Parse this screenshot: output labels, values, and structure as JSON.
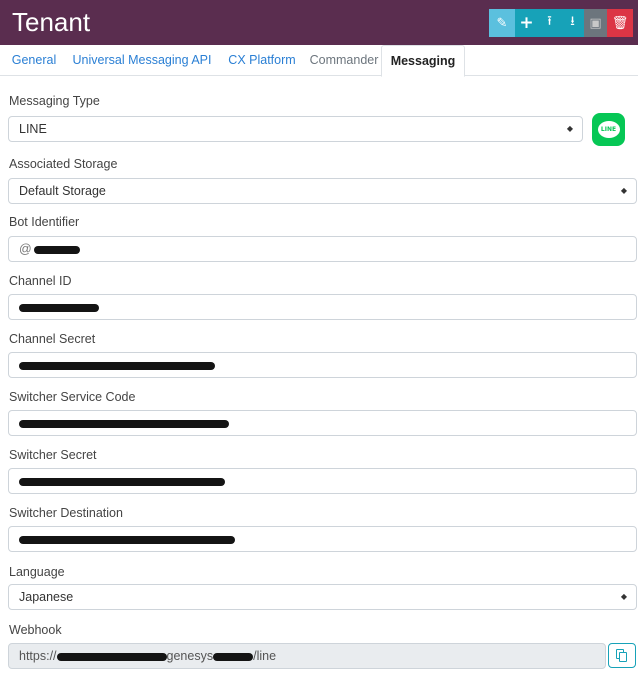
{
  "header": {
    "title": "Tenant",
    "actions": [
      {
        "name": "edit",
        "icon": "pencil-icon",
        "glyph": "✎"
      },
      {
        "name": "add",
        "icon": "plus-icon",
        "glyph": "+"
      },
      {
        "name": "upload",
        "icon": "upload-icon",
        "glyph": "⭱"
      },
      {
        "name": "download",
        "icon": "download-icon",
        "glyph": "⭳"
      },
      {
        "name": "save",
        "icon": "save-icon",
        "glyph": "▣"
      },
      {
        "name": "delete",
        "icon": "trash-icon",
        "glyph": "🗑"
      }
    ]
  },
  "tabs": [
    {
      "label": "General",
      "active": false
    },
    {
      "label": "Universal Messaging API",
      "active": false
    },
    {
      "label": "CX Platform",
      "active": false
    },
    {
      "label": "Commander",
      "active": false
    },
    {
      "label": "Messaging",
      "active": true
    }
  ],
  "form": {
    "messaging_type": {
      "label": "Messaging Type",
      "value": "LINE",
      "badge": "LINE"
    },
    "associated_storage": {
      "label": "Associated Storage",
      "value": "Default Storage"
    },
    "bot_identifier": {
      "label": "Bot Identifier",
      "prefix": "@"
    },
    "channel_id": {
      "label": "Channel ID"
    },
    "channel_secret": {
      "label": "Channel Secret"
    },
    "switcher_service_code": {
      "label": "Switcher Service Code"
    },
    "switcher_secret": {
      "label": "Switcher Secret"
    },
    "switcher_destination": {
      "label": "Switcher Destination"
    },
    "language": {
      "label": "Language",
      "value": "Japanese"
    },
    "webhook": {
      "label": "Webhook",
      "prefix": "https://",
      "middle": "genesys",
      "suffix": "/line"
    }
  },
  "colors": {
    "header_bg": "#5a2d4f",
    "accent": "#17a2b8",
    "danger": "#dc3545",
    "line_green": "#06c755",
    "link": "#2a7fd4"
  }
}
